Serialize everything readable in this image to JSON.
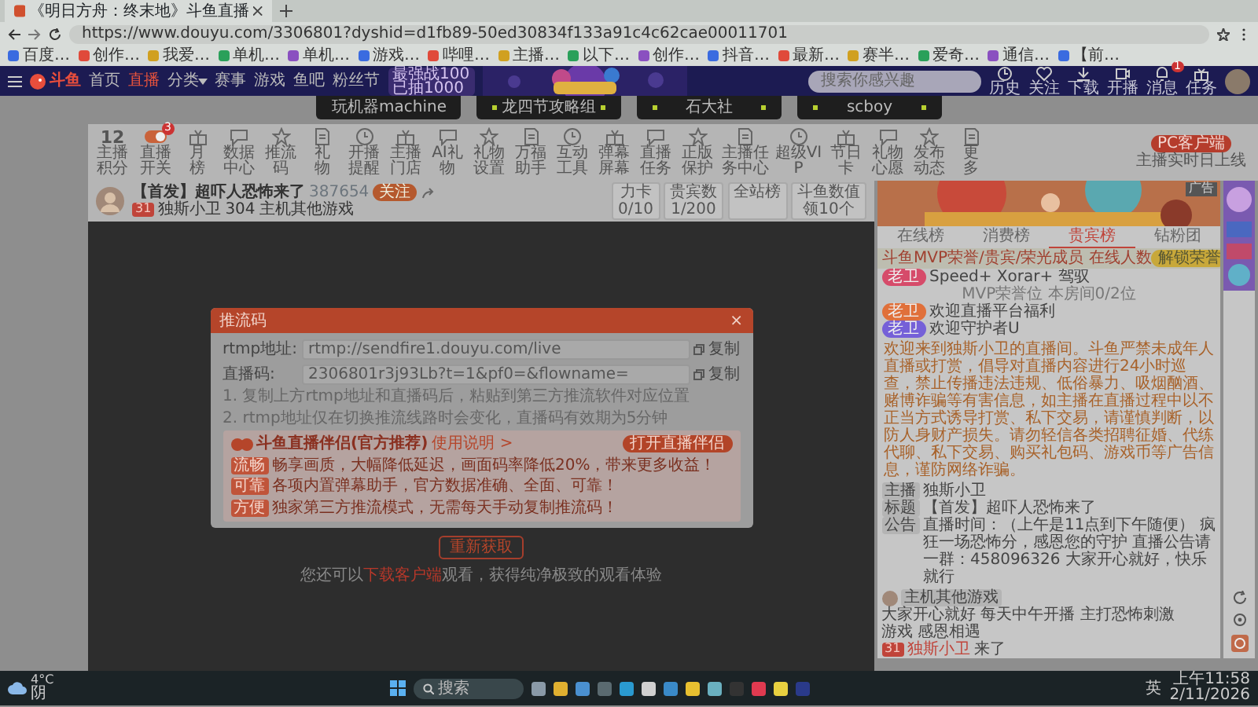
{
  "browser": {
    "tab_title": "《明日方舟：终末地》斗鱼直播",
    "url": "https://www.douyu.com/3306801?dyshid=d1fb89-50ed30834f133a91c4c62cae00011701",
    "bookmarks": [
      "百度…",
      "创作…",
      "我爱…",
      "单机…",
      "单机…",
      "游戏…",
      "哔哩…",
      "主播…",
      "以下…",
      "创作…",
      "抖音…",
      "最新…",
      "赛半…",
      "爱奇…",
      "通信…",
      "【前…"
    ]
  },
  "nav": {
    "logo": "斗鱼",
    "items": [
      {
        "label": "首页",
        "selected": false,
        "menu": false
      },
      {
        "label": "直播",
        "selected": true,
        "menu": false
      },
      {
        "label": "分类",
        "selected": false,
        "menu": true
      },
      {
        "label": "赛事",
        "selected": false,
        "menu": false
      },
      {
        "label": "游戏",
        "selected": false,
        "menu": false
      },
      {
        "label": "鱼吧",
        "selected": false,
        "menu": false
      },
      {
        "label": "粉丝节",
        "selected": false,
        "menu": false
      }
    ],
    "promo": {
      "line1": "最强战100",
      "line2": "已抽1000"
    },
    "search": {
      "placeholder": "搜索你感兴趣"
    },
    "actions": [
      {
        "label": "历史"
      },
      {
        "label": "关注"
      },
      {
        "label": "下载"
      },
      {
        "label": "开播"
      },
      {
        "label": "消息",
        "badge": "1"
      },
      {
        "label": "任务"
      }
    ]
  },
  "category_tabs": [
    "玩机器machine",
    "龙四节攻略组",
    "石大社",
    "scboy"
  ],
  "toolbar": {
    "score": "12",
    "score_label": "主播积分",
    "items": [
      {
        "label": "直播开关",
        "kind": "toggle",
        "on": true,
        "badge": "3"
      },
      {
        "label": "月榜",
        "kind": "icon"
      },
      {
        "label": "数据中心",
        "kind": "icon"
      },
      {
        "label": "推流码",
        "kind": "icon"
      },
      {
        "label": "礼物",
        "kind": "icon"
      },
      {
        "label": "开播提醒",
        "kind": "icon"
      },
      {
        "label": "主播门店",
        "kind": "icon"
      },
      {
        "label": "AI礼物",
        "kind": "icon"
      },
      {
        "label": "礼物设置",
        "kind": "icon"
      },
      {
        "label": "万福助手",
        "kind": "icon"
      },
      {
        "label": "互动工具",
        "kind": "icon"
      },
      {
        "label": "弹幕屏幕",
        "kind": "icon"
      },
      {
        "label": "直播任务",
        "kind": "icon"
      },
      {
        "label": "正版保护",
        "kind": "icon"
      },
      {
        "label": "主播任务中心",
        "kind": "icon"
      },
      {
        "label": "超级VIP",
        "kind": "icon"
      },
      {
        "label": "节日卡",
        "kind": "icon"
      },
      {
        "label": "礼物心愿",
        "kind": "icon"
      },
      {
        "label": "发布动态",
        "kind": "icon"
      },
      {
        "label": "更多",
        "kind": "icon"
      }
    ],
    "pc_client": "PC客户端",
    "pc_note": "主播实时日上线"
  },
  "streamer": {
    "title": "【首发】超吓人恐怖来了",
    "room": "387654",
    "follow": "关注",
    "level": "31",
    "name": "独斯小卫",
    "fans": "304",
    "category": "主机其他游戏",
    "stats": [
      {
        "top": "力卡",
        "bottom": "0/10"
      },
      {
        "top": "贵宾数",
        "bottom": "1/200"
      },
      {
        "top": "全站榜"
      },
      {
        "top": "斗鱼数值",
        "bottom": "领10个"
      }
    ]
  },
  "modal": {
    "title": "推流码",
    "close": "×",
    "fields": [
      {
        "label": "rtmp地址:",
        "value": "rtmp://sendfire1.douyu.com/live",
        "copy": "复制"
      },
      {
        "label": "直播码:",
        "value": "2306801r3j93Lb?t=1&pf0=&flowname=",
        "copy": "复制"
      }
    ],
    "notes": [
      "1. 复制上方rtmp地址和直播码后，粘贴到第三方推流软件对应位置",
      "2. rtmp地址仅在切换推流线路时会变化，直播码有效期为5分钟"
    ],
    "promo": {
      "title": "斗鱼直播伴侣(官方推荐)",
      "help": "使用说明 >",
      "button": "打开直播伴侣",
      "rows": [
        {
          "tag": "流畅",
          "text": "畅享画质，大幅降低延迟，画面码率降低20%，带来更多收益！"
        },
        {
          "tag": "可靠",
          "text": "各项内置弹幕助手，官方数据准确、全面、可靠！"
        },
        {
          "tag": "方便",
          "text": "独家第三方推流模式，无需每天手动复制推流码！"
        }
      ]
    }
  },
  "refetch": "重新获取",
  "video_note": {
    "before": "您还可以",
    "link": "下载客户端",
    "after": "观看，获得纯净极致的观看体验"
  },
  "sidebar": {
    "ad_badge": "广告",
    "tabs": [
      {
        "label": "在线榜",
        "selected": false
      },
      {
        "label": "消费榜",
        "selected": false
      },
      {
        "label": "贵宾榜",
        "selected": true
      },
      {
        "label": "钻粉团",
        "selected": false
      }
    ],
    "fan_bar": {
      "text": "斗鱼MVP荣誉/贵宾/荣光成员 在线人数",
      "button": "解锁荣誉"
    },
    "chat": [
      {
        "badge": "老卫",
        "text": "Speed+ Xorar+ 驾驭",
        "color": "#d64b6a"
      },
      {
        "badge": "老卫",
        "text": "欢迎直播平台福利",
        "color": "#e0703a"
      },
      {
        "badge": "老卫",
        "text": "欢迎守护者U",
        "color": "#7560d8"
      }
    ],
    "mvp_note": "MVP荣誉位 本房间0/2位",
    "announcement": "欢迎来到独斯小卫的直播间。斗鱼严禁未成年人直播或打赏，倡导对直播内容进行24小时巡查，禁止传播违法违规、低俗暴力、吸烟酗酒、赌博诈骗等有害信息，如主播在直播过程中以不正当方式诱导打赏、私下交易，请谨慎判断，以防人身财产损失。请勿轻信各类招聘征婚、代练代聊、私下交易、购买礼包码、游戏币等广告信息，谨防网络诈骗。",
    "info": [
      {
        "tag": "主播",
        "text": "独斯小卫"
      },
      {
        "tag": "标题",
        "text": "【首发】超吓人恐怖来了"
      },
      {
        "tag": "公告",
        "text": "直播时间：（上午是11点到下午随便） 疯狂一场恐怖分，感恩您的守护 直播公告请一群：458096326 大家开心就好，快乐就行"
      }
    ],
    "category_tag": "主机其他游戏",
    "intro": "大家开心就好 每天中午开播 主打恐怖刺激游戏 感恩相遇",
    "entry": {
      "level": "31",
      "name": "独斯小卫",
      "text": "来了"
    }
  },
  "taskbar": {
    "temp": "4°C",
    "weather": "阴",
    "search": "搜索",
    "ime": "英",
    "time": "上午11:58",
    "date": "2/11/2026"
  }
}
